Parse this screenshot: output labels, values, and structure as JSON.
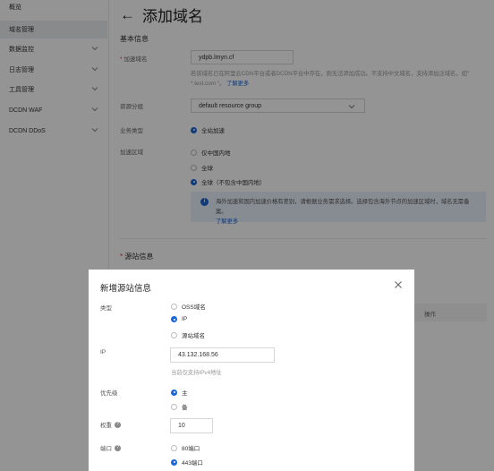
{
  "sidebar": {
    "items": [
      {
        "label": "概览",
        "active": false,
        "expandable": false
      },
      {
        "label": "域名管理",
        "active": true,
        "expandable": false
      },
      {
        "label": "数据监控",
        "active": false,
        "expandable": true
      },
      {
        "label": "日志管理",
        "active": false,
        "expandable": true
      },
      {
        "label": "工具管理",
        "active": false,
        "expandable": true
      },
      {
        "label": "DCDN WAF",
        "active": false,
        "expandable": true
      },
      {
        "label": "DCDN DDoS",
        "active": false,
        "expandable": true
      }
    ]
  },
  "page": {
    "title": "添加域名",
    "basic_section": "基本信息",
    "domain": {
      "label": "加速域名",
      "value": "ydpb.lmyn.cf",
      "help": "若该域名已在阿里云CDN平台或者DCDN平台中存在，则无法添加成功。不支持中文域名，支持添加泛域名，如\" *.test.com \"。",
      "help_link": "了解更多"
    },
    "resource_group": {
      "label": "资源分组",
      "value": "default resource group"
    },
    "business_type": {
      "label": "业务类型",
      "option": "全站加速"
    },
    "region": {
      "label": "加速区域",
      "options": [
        "仅中国内地",
        "全球",
        "全球（不包含中国内地）"
      ],
      "selected_index": 2,
      "notice": "海外加速和国内加速价格有差别，请根据业务需求选择。选择包含海外节点的加速区域时，域名无需备案。",
      "notice_link": "了解更多"
    },
    "origin_section": "源站信息",
    "table_op_header": "操作"
  },
  "modal": {
    "title": "新增源站信息",
    "type": {
      "label": "类型",
      "options": [
        "OSS域名",
        "IP",
        "源站域名"
      ],
      "selected_index": 1
    },
    "ip": {
      "label": "IP",
      "value": "43.132.168.56",
      "help": "当前仅支持IPv4地址"
    },
    "priority": {
      "label": "优先级",
      "options": [
        "主",
        "备"
      ],
      "selected_index": 0
    },
    "weight": {
      "label": "权重",
      "value": "10"
    },
    "port": {
      "label": "端口",
      "options": [
        "80端口",
        "443端口"
      ],
      "selected_index": 1
    }
  },
  "colors": {
    "accent": "#1a66d6",
    "required": "#e03030",
    "sidebar_active": "#eceef2"
  }
}
